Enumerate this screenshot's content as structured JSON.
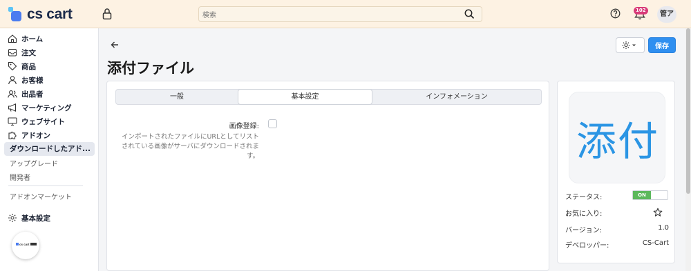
{
  "header": {
    "logo_text": "cs cart",
    "search_placeholder": "検索",
    "notification_count": "102",
    "user_initials": "管ア"
  },
  "sidebar": {
    "items": [
      {
        "label": "ホーム",
        "icon": "home-icon"
      },
      {
        "label": "注文",
        "icon": "inbox-icon"
      },
      {
        "label": "商品",
        "icon": "tag-icon"
      },
      {
        "label": "お客様",
        "icon": "user-icon"
      },
      {
        "label": "出品者",
        "icon": "users-icon"
      },
      {
        "label": "マーケティング",
        "icon": "megaphone-icon"
      },
      {
        "label": "ウェブサイト",
        "icon": "monitor-icon"
      },
      {
        "label": "アドオン",
        "icon": "puzzle-icon"
      }
    ],
    "active_sub": "ダウンロードしたアド...",
    "sub_items": [
      "アップグレード",
      "開発者"
    ],
    "marketplace": "アドオンマーケット",
    "settings": "基本設定"
  },
  "page": {
    "title": "添付ファイル",
    "save_label": "保存"
  },
  "tabs": [
    {
      "label": "一般",
      "active": false
    },
    {
      "label": "基本設定",
      "active": true
    },
    {
      "label": "インフォメーション",
      "active": false
    }
  ],
  "setting": {
    "label": "画像登録:",
    "help": "インポートされたファイルにURLとしてリストされている画像がサーバにダウンロードされます。",
    "checked": false
  },
  "addon_info": {
    "icon_text": "添付",
    "status_label": "ステータス:",
    "status_value": "ON",
    "favorite_label": "お気に入り:",
    "version_label": "バージョン:",
    "version_value": "1.0",
    "developer_label": "デベロッパー:",
    "developer_value": "CS-Cart"
  },
  "colors": {
    "topbar_bg": "#fdf2e3",
    "accent": "#2f8ff0",
    "status_on": "#5cb85c",
    "icon_blue": "#2b95e4",
    "badge": "#d83a78"
  }
}
